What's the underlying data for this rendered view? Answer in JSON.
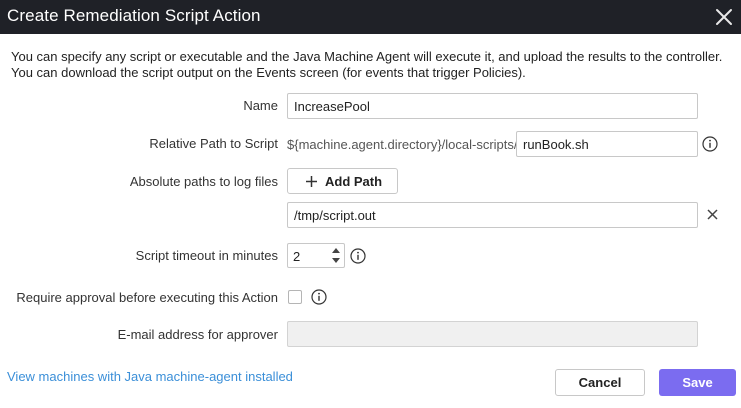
{
  "dialog": {
    "title": "Create Remediation Script Action",
    "close_icon": "close-icon"
  },
  "intro": "You can specify any script or executable and the Java Machine Agent will execute it, and upload the results to the controller. You can download the script output on the Events screen (for events that trigger Policies).",
  "form": {
    "name": {
      "label": "Name",
      "value": "IncreasePool"
    },
    "relative_path": {
      "label": "Relative Path to Script",
      "prefix": "${machine.agent.directory}/local-scripts/",
      "value": "runBook.sh",
      "info_icon": "info-icon"
    },
    "log_files": {
      "label": "Absolute paths to log files",
      "add_button_label": "Add Path",
      "add_icon": "plus-icon",
      "paths": [
        "/tmp/script.out"
      ],
      "remove_icon": "close-icon"
    },
    "timeout": {
      "label": "Script timeout in minutes",
      "value": "2",
      "info_icon": "info-icon"
    },
    "require_approval": {
      "label": "Require approval before executing this Action",
      "checked": false,
      "info_icon": "info-icon"
    },
    "approver_email": {
      "label": "E-mail address for approver",
      "value": "",
      "disabled": true
    }
  },
  "footer": {
    "link": "View machines with Java machine-agent installed",
    "cancel_label": "Cancel",
    "save_label": "Save"
  },
  "colors": {
    "titlebar_bg": "#1f2127",
    "link": "#3b8fd8",
    "primary_button": "#7b6cf0"
  }
}
